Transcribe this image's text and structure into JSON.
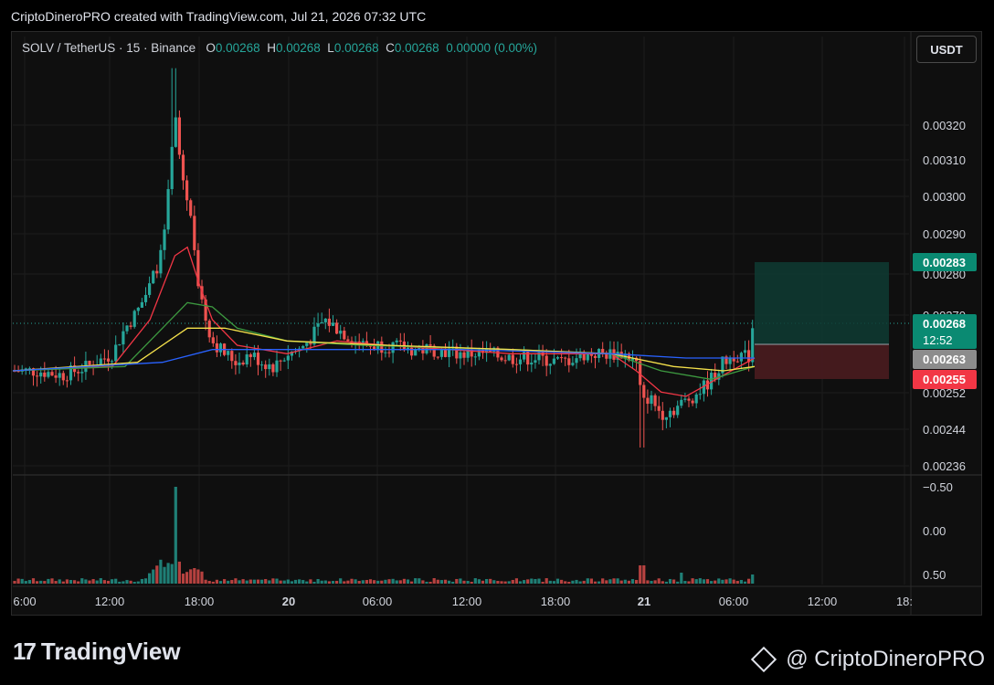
{
  "header": {
    "text": "CriptoDineroPRO created with TradingView.com, Jul 21, 2026 07:32 UTC"
  },
  "legend": {
    "symbol": "SOLV / TetherUS · 15 · Binance",
    "o_label": "O",
    "o_value": "0.00268",
    "h_label": "H",
    "h_value": "0.00268",
    "l_label": "L",
    "l_value": "0.00268",
    "c_label": "C",
    "c_value": "0.00268",
    "change": "0.00000 (0.00%)"
  },
  "currency_button": "USDT",
  "price_labels": {
    "target": "0.00283",
    "current": "0.00268",
    "countdown": "12:52",
    "entry": "0.00263",
    "stop": "0.00255"
  },
  "colors": {
    "up": "#26a69a",
    "down": "#ef5350",
    "ma_red": "#f23645",
    "ma_green": "#3d9a40",
    "ma_yellow": "#f5e14b",
    "ma_blue": "#2962ff"
  },
  "footer": {
    "brand": "TradingView",
    "user": "@ CriptoDineroPRO"
  },
  "chart_data": {
    "type": "candlestick",
    "interval": "15",
    "y_ticks": [
      "0.00320",
      "0.00310",
      "0.00300",
      "0.00290",
      "0.00280",
      "0.00270",
      "0.00252",
      "0.00244",
      "0.00236"
    ],
    "y_tick_values": [
      0.0032,
      0.0031,
      0.003,
      0.0029,
      0.0028,
      0.0027,
      0.00252,
      0.00244,
      0.00236
    ],
    "x_ticks": [
      "6:00",
      "12:00",
      "18:00",
      "20",
      "06:00",
      "12:00",
      "18:00",
      "21",
      "06:00",
      "12:00",
      "18:"
    ],
    "volume_ticks": [
      "−0.50",
      "0.00",
      "0.50"
    ],
    "close_path": [
      [
        0,
        0.00258
      ],
      [
        2,
        0.00258
      ],
      [
        4,
        0.00257
      ],
      [
        6,
        0.00259
      ],
      [
        8,
        0.00262
      ],
      [
        9,
        0.00268
      ],
      [
        10,
        0.00272
      ],
      [
        11,
        0.00278
      ],
      [
        12,
        0.00286
      ],
      [
        12.5,
        0.003
      ],
      [
        13,
        0.00318
      ],
      [
        13.5,
        0.00305
      ],
      [
        14,
        0.00298
      ],
      [
        14.5,
        0.0029
      ],
      [
        15,
        0.00275
      ],
      [
        15.5,
        0.0027
      ],
      [
        16,
        0.00265
      ],
      [
        17,
        0.00262
      ],
      [
        18,
        0.0026
      ],
      [
        19,
        0.00262
      ],
      [
        20,
        0.0026
      ],
      [
        21,
        0.00259
      ],
      [
        22,
        0.00262
      ],
      [
        23,
        0.00263
      ],
      [
        24,
        0.00266
      ],
      [
        25,
        0.0027
      ],
      [
        26,
        0.00268
      ],
      [
        27,
        0.00266
      ],
      [
        28,
        0.00264
      ],
      [
        30,
        0.00264
      ],
      [
        32,
        0.00263
      ],
      [
        34,
        0.00263
      ],
      [
        36,
        0.00262
      ],
      [
        38,
        0.00262
      ],
      [
        40,
        0.00261
      ],
      [
        42,
        0.00261
      ],
      [
        44,
        0.0026
      ],
      [
        46,
        0.00262
      ],
      [
        48,
        0.00262
      ],
      [
        49,
        0.00262
      ],
      [
        50,
        0.0026
      ],
      [
        50.5,
        0.0025
      ],
      [
        51,
        0.00252
      ],
      [
        52,
        0.00248
      ],
      [
        53,
        0.00249
      ],
      [
        54,
        0.00251
      ],
      [
        55,
        0.00253
      ],
      [
        56,
        0.00256
      ],
      [
        57,
        0.0026
      ],
      [
        58,
        0.00262
      ],
      [
        59,
        0.00261
      ],
      [
        59.5,
        0.00268
      ]
    ],
    "moving_averages": [
      {
        "color_key": "ma_red",
        "values": [
          [
            0,
            0.00258
          ],
          [
            8,
            0.00259
          ],
          [
            11,
            0.0027
          ],
          [
            13,
            0.00285
          ],
          [
            14,
            0.00287
          ],
          [
            15,
            0.00278
          ],
          [
            16,
            0.0027
          ],
          [
            18,
            0.00264
          ],
          [
            22,
            0.00262
          ],
          [
            26,
            0.00265
          ],
          [
            30,
            0.00264
          ],
          [
            40,
            0.00262
          ],
          [
            48,
            0.00262
          ],
          [
            50,
            0.00258
          ],
          [
            52,
            0.00253
          ],
          [
            54,
            0.00252
          ],
          [
            57,
            0.00257
          ],
          [
            59.5,
            0.00261
          ]
        ]
      },
      {
        "color_key": "ma_green",
        "values": [
          [
            0,
            0.00258
          ],
          [
            9,
            0.00259
          ],
          [
            12,
            0.00268
          ],
          [
            14,
            0.00274
          ],
          [
            16,
            0.00273
          ],
          [
            18,
            0.00268
          ],
          [
            22,
            0.00265
          ],
          [
            28,
            0.00264
          ],
          [
            40,
            0.00263
          ],
          [
            48,
            0.00262
          ],
          [
            52,
            0.00258
          ],
          [
            56,
            0.00256
          ],
          [
            59.5,
            0.00259
          ]
        ]
      },
      {
        "color_key": "ma_yellow",
        "values": [
          [
            0,
            0.00258
          ],
          [
            10,
            0.0026
          ],
          [
            14,
            0.00268
          ],
          [
            17,
            0.00268
          ],
          [
            22,
            0.00265
          ],
          [
            30,
            0.00264
          ],
          [
            40,
            0.00263
          ],
          [
            48,
            0.00262
          ],
          [
            53,
            0.00259
          ],
          [
            57,
            0.00258
          ],
          [
            59.5,
            0.00259
          ]
        ]
      },
      {
        "color_key": "ma_blue",
        "values": [
          [
            0,
            0.00258
          ],
          [
            12,
            0.0026
          ],
          [
            16,
            0.00263
          ],
          [
            24,
            0.00263
          ],
          [
            36,
            0.00263
          ],
          [
            48,
            0.00262
          ],
          [
            54,
            0.00261
          ],
          [
            59.5,
            0.00261
          ]
        ]
      }
    ],
    "position": {
      "entry": 0.00263,
      "target": 0.00283,
      "stop": 0.00255
    },
    "volume": {
      "spike_index": 13,
      "other_spikes": [
        11,
        12,
        14,
        15,
        50.5,
        59.5
      ]
    }
  }
}
